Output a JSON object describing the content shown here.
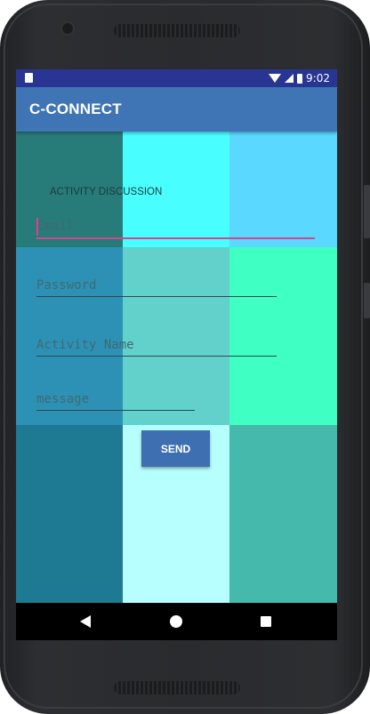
{
  "status_bar": {
    "time": "9:02"
  },
  "app_bar": {
    "title": "C-CONNECT"
  },
  "form": {
    "heading": "ACTIVITY DISCUSSION",
    "email_placeholder": "Email",
    "password_placeholder": "Password",
    "activity_name_placeholder": "Activity Name",
    "message_placeholder": "message",
    "send_label": "SEND"
  },
  "colors": {
    "status_bar": "#283593",
    "app_bar": "#3f74b5",
    "accent": "#e0408a",
    "grid": [
      "#277b79",
      "#48feff",
      "#5ad8ff",
      "#2d91b5",
      "#62d1cb",
      "#40ffc2",
      "#1e7993",
      "#b7feff",
      "#46b9ad"
    ],
    "send_button": "#3e6fb0"
  },
  "icons": [
    "sim-card-icon",
    "wifi-icon",
    "signal-icon",
    "battery-icon",
    "back-icon",
    "home-icon",
    "recents-icon"
  ]
}
